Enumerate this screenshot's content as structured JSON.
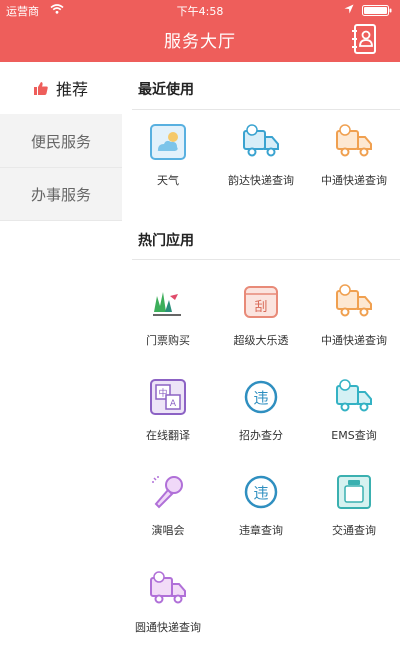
{
  "status_bar": {
    "carrier": "运营商",
    "time": "下午4:58"
  },
  "header": {
    "title": "服务大厅"
  },
  "sidebar": {
    "items": [
      {
        "label": "推荐",
        "active": true
      },
      {
        "label": "便民服务"
      },
      {
        "label": "办事服务"
      }
    ]
  },
  "recent": {
    "title": "最近使用",
    "apps": [
      {
        "label": "天气",
        "icon": "weather-icon"
      },
      {
        "label": "韵达快递查询",
        "icon": "delivery-truck-icon"
      },
      {
        "label": "中通快递查询",
        "icon": "delivery-truck-icon"
      }
    ]
  },
  "popular": {
    "title": "热门应用",
    "apps": [
      {
        "label": "门票购买",
        "icon": "ticket-logo-icon"
      },
      {
        "label": "超级大乐透",
        "icon": "lottery-icon"
      },
      {
        "label": "中通快递查询",
        "icon": "delivery-truck-icon"
      },
      {
        "label": "在线翻译",
        "icon": "translate-icon"
      },
      {
        "label": "招办查分",
        "icon": "violation-icon"
      },
      {
        "label": "EMS查询",
        "icon": "delivery-truck-icon"
      },
      {
        "label": "演唱会",
        "icon": "microphone-icon"
      },
      {
        "label": "违章查询",
        "icon": "violation-icon"
      },
      {
        "label": "交通查询",
        "icon": "traffic-card-icon"
      },
      {
        "label": "圆通快递查询",
        "icon": "delivery-truck-icon"
      }
    ]
  },
  "colors": {
    "brand": "#ee5e5b",
    "accent_orange": "#f0a050",
    "accent_blue": "#3aa3d0",
    "accent_purple": "#b070d8",
    "accent_teal": "#34b2c4"
  }
}
